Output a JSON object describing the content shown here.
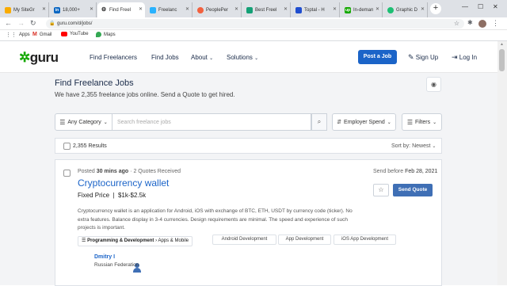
{
  "browser": {
    "tabs": [
      {
        "label": "My SiteGr",
        "icon": "google-sites-icon",
        "color": "#f9ab00"
      },
      {
        "label": "18,000+ ",
        "icon": "linkedin-icon",
        "color": "#0a66c2"
      },
      {
        "label": "Find Freel",
        "icon": "guru-icon",
        "color": "#222222"
      },
      {
        "label": "Freelanc",
        "icon": "freelancer-icon",
        "color": "#29b2fe"
      },
      {
        "label": "PeoplePer",
        "icon": "peopleperhour-icon",
        "color": "#f2613f"
      },
      {
        "label": "Best Freel",
        "icon": "bookmark-icon",
        "color": "#14a076"
      },
      {
        "label": "Toptal - H",
        "icon": "toptal-icon",
        "color": "#204ecf"
      },
      {
        "label": "In-deman",
        "icon": "upwork-icon",
        "color": "#14a800"
      },
      {
        "label": "Graphic D",
        "icon": "graphic-icon",
        "color": "#1dbf73"
      }
    ],
    "address": "guru.com/d/jobs/",
    "bookmarks": [
      {
        "label": "Apps",
        "icon": "apps-grid-icon"
      },
      {
        "label": "Gmail",
        "icon": "gmail-icon"
      },
      {
        "label": "YouTube",
        "icon": "youtube-icon"
      },
      {
        "label": "Maps",
        "icon": "maps-icon"
      }
    ]
  },
  "header": {
    "logo": "guru",
    "nav": [
      "Find Freelancers",
      "Find Jobs",
      "About",
      "Solutions"
    ],
    "post_job": "Post a Job",
    "sign_up": "Sign Up",
    "log_in": "Log In"
  },
  "page": {
    "title": "Find Freelance Jobs",
    "subtitle": "We have 2,355 freelance jobs online. Send a Quote to get hired."
  },
  "filters": {
    "category": "Any Category",
    "search_placeholder": "Search freelance jobs",
    "employer_spend": "Employer Spend",
    "filters": "Filters"
  },
  "results": {
    "count": "2,355 Results",
    "sort_label": "Sort by:",
    "sort_value": "Newest"
  },
  "job": {
    "posted_prefix": "Posted",
    "posted_time": "30 mins ago",
    "quotes": "2 Quotes Received",
    "send_before_prefix": "Send before",
    "send_before_date": "Feb 28, 2021",
    "title": "Cryptocurrency wallet",
    "price_type": "Fixed Price",
    "price_range": "$1k-$2.5k",
    "description": "Cryptocurrency wallet is an application for Android, iOS with exchange of BTC, ETH, USDT by currency code (ticker). No extra features. Balance display in 3-4 currencies. Design requirements are minimal. The speed and experience of such projects is important.",
    "category": "Programming & Development",
    "subcategory": "Apps & Mobile",
    "skills": [
      "Android Development",
      "App Development",
      "iOS App Development"
    ],
    "send_quote": "Send Quote",
    "employer_name": "Dmitry I",
    "employer_country": "Russian Federation"
  }
}
